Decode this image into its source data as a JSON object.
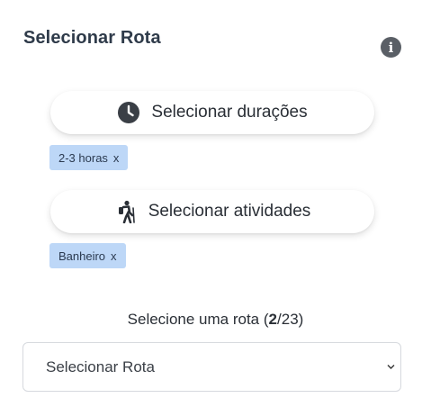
{
  "header": {
    "title": "Selecionar Rota",
    "info_icon": "info-circle-icon"
  },
  "durations": {
    "button_label": "Selecionar durações",
    "icon": "clock-icon",
    "selected_tags": [
      {
        "label": "2-3 horas",
        "remove": "x"
      }
    ]
  },
  "activities": {
    "button_label": "Selecionar atividades",
    "icon": "hiking-icon",
    "selected_tags": [
      {
        "label": "Banheiro",
        "remove": "x"
      }
    ]
  },
  "route_count": {
    "prefix": "Selecione uma rota (",
    "current": "2",
    "separator": "/",
    "total": "23",
    "suffix": ")"
  },
  "route_select": {
    "selected": "Selecionar Rota"
  },
  "colors": {
    "tag_bg": "#bdd7f7",
    "title": "#2f3b4a"
  }
}
